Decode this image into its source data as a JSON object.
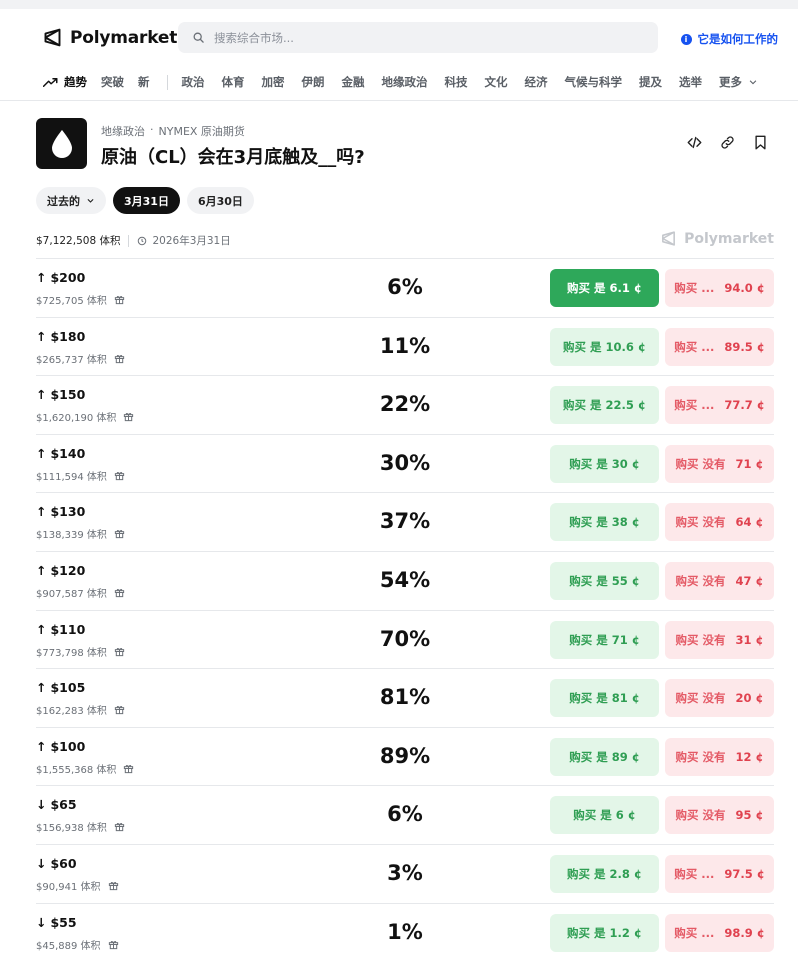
{
  "header": {
    "brand": "Polymarket",
    "search_placeholder": "搜索综合市场...",
    "how_it_works": "它是如何工作的"
  },
  "nav": {
    "primary": [
      {
        "label": "趋势",
        "active": true
      },
      {
        "label": "突破"
      },
      {
        "label": "新"
      }
    ],
    "categories": [
      "政治",
      "体育",
      "加密",
      "伊朗",
      "金融",
      "地缘政治",
      "科技",
      "文化",
      "经济",
      "气候与科学",
      "提及",
      "选举"
    ],
    "more": "更多"
  },
  "event": {
    "breadcrumb_category": "地缘政治",
    "breadcrumb_dot": "·",
    "breadcrumb_sub": "NYMEX 原油期货",
    "title": "原油（CL）会在3月底触及__吗?"
  },
  "date_tabs": {
    "past": "过去的",
    "mar31": "3月31日",
    "jun30": "6月30日"
  },
  "meta": {
    "volume": "$7,122,508 体积",
    "end_date": "2026年3月31日",
    "watermark": "Polymarket"
  },
  "markets": [
    {
      "label": "$200",
      "direction": "up",
      "volume": "$725,705 体积",
      "pct": "6%",
      "yes": "购买 是 6.1 ¢",
      "no_prefix": "购买 ...",
      "no_price": "94.0 ¢",
      "highlight": true
    },
    {
      "label": "$180",
      "direction": "up",
      "volume": "$265,737 体积",
      "pct": "11%",
      "yes": "购买 是 10.6 ¢",
      "no_prefix": "购买 ...",
      "no_price": "89.5 ¢"
    },
    {
      "label": "$150",
      "direction": "up",
      "volume": "$1,620,190 体积",
      "pct": "22%",
      "yes": "购买 是 22.5 ¢",
      "no_prefix": "购买 ...",
      "no_price": "77.7 ¢"
    },
    {
      "label": "$140",
      "direction": "up",
      "volume": "$111,594 体积",
      "pct": "30%",
      "yes": "购买 是 30 ¢",
      "no_prefix": "购买 没有",
      "no_price": "71 ¢"
    },
    {
      "label": "$130",
      "direction": "up",
      "volume": "$138,339 体积",
      "pct": "37%",
      "yes": "购买 是 38 ¢",
      "no_prefix": "购买 没有",
      "no_price": "64 ¢"
    },
    {
      "label": "$120",
      "direction": "up",
      "volume": "$907,587 体积",
      "pct": "54%",
      "yes": "购买 是 55 ¢",
      "no_prefix": "购买 没有",
      "no_price": "47 ¢"
    },
    {
      "label": "$110",
      "direction": "up",
      "volume": "$773,798 体积",
      "pct": "70%",
      "yes": "购买 是 71 ¢",
      "no_prefix": "购买 没有",
      "no_price": "31 ¢"
    },
    {
      "label": "$105",
      "direction": "up",
      "volume": "$162,283 体积",
      "pct": "81%",
      "yes": "购买 是 81 ¢",
      "no_prefix": "购买 没有",
      "no_price": "20 ¢"
    },
    {
      "label": "$100",
      "direction": "up",
      "volume": "$1,555,368 体积",
      "pct": "89%",
      "yes": "购买 是 89 ¢",
      "no_prefix": "购买 没有",
      "no_price": "12 ¢"
    },
    {
      "label": "$65",
      "direction": "down",
      "volume": "$156,938 体积",
      "pct": "6%",
      "yes": "购买 是 6 ¢",
      "no_prefix": "购买 没有",
      "no_price": "95 ¢"
    },
    {
      "label": "$60",
      "direction": "down",
      "volume": "$90,941 体积",
      "pct": "3%",
      "yes": "购买 是 2.8 ¢",
      "no_prefix": "购买 ...",
      "no_price": "97.5 ¢"
    },
    {
      "label": "$55",
      "direction": "down",
      "volume": "$45,889 体积",
      "pct": "1%",
      "yes": "购买 是 1.2 ¢",
      "no_prefix": "购买 ...",
      "no_price": "98.9 ¢"
    }
  ],
  "icons": {
    "arrow_up": "↑",
    "arrow_down": "↓"
  },
  "colors": {
    "yes_bg": "#e3f6e8",
    "yes_text": "#2f9e53",
    "yes_hot_bg": "#2ea85a",
    "no_bg": "#fde8ea",
    "no_text": "#e0424f",
    "link_blue": "#1652f0"
  }
}
